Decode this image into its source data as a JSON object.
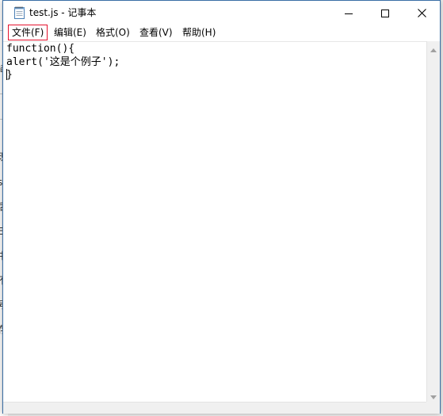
{
  "window": {
    "title": "test.js - 记事本"
  },
  "menu": {
    "items": [
      {
        "label": "文件(F)",
        "active": true
      },
      {
        "label": "编辑(E)"
      },
      {
        "label": "格式(O)"
      },
      {
        "label": "查看(V)"
      },
      {
        "label": "帮助(H)"
      }
    ]
  },
  "editor": {
    "lines": [
      "function(){",
      "alert('这是个例子');",
      "}"
    ]
  },
  "background_glyphs": [
    "现",
    "s\"",
    "后",
    "E!",
    "中",
    "不",
    "号",
    "存"
  ],
  "colors": {
    "active_menu_border": "#e5132e",
    "window_border": "#3a6ea5"
  },
  "icons": {
    "title_icon": "notepad-icon",
    "minimize": "minimize-icon",
    "maximize": "maximize-icon",
    "close": "close-icon"
  }
}
